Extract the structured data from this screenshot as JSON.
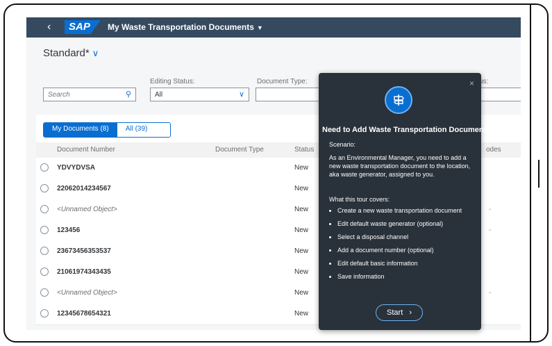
{
  "shell": {
    "back_icon": "chevron-left-icon",
    "logo_text": "SAP",
    "app_title": "My Waste Transportation Documents",
    "title_caret": "▼",
    "brand_color": "#0a6ed1",
    "bar_color": "#354a5f"
  },
  "variant": {
    "name": "Standard*",
    "chevron": "∨"
  },
  "filters": {
    "search_placeholder": "Search",
    "editing_status_label": "Editing Status:",
    "editing_status_value": "All",
    "document_type_label": "Document Type:",
    "document_type_value": "",
    "partial_label": "us:"
  },
  "segments": {
    "my_documents": "My Documents (8)",
    "all": "All (39)"
  },
  "table": {
    "columns": [
      "Document Number",
      "Document Type",
      "Status",
      "odes"
    ],
    "rows": [
      {
        "number": "YDVYDVSA",
        "status": "New",
        "italic": false,
        "dash": ""
      },
      {
        "number": "22062014234567",
        "status": "New",
        "italic": false,
        "dash": ""
      },
      {
        "number": "<Unnamed Object>",
        "status": "New",
        "italic": true,
        "dash": "-"
      },
      {
        "number": "123456",
        "status": "New",
        "italic": false,
        "dash": "-"
      },
      {
        "number": "23673456353537",
        "status": "New",
        "italic": false,
        "dash": ""
      },
      {
        "number": "21061974343435",
        "status": "New",
        "italic": false,
        "dash": ""
      },
      {
        "number": "<Unnamed Object>",
        "status": "New",
        "italic": true,
        "dash": "-"
      },
      {
        "number": "12345678654321",
        "status": "New",
        "italic": false,
        "dash": ""
      }
    ]
  },
  "tour": {
    "close_symbol": "×",
    "icon": "signpost-icon",
    "title": "Need to Add Waste Transportation Document",
    "scenario_label": "Scenario:",
    "scenario_text": "As an Environmental Manager, you need to add a new waste transportation document to the location, aka waste generator, assigned to you.",
    "covers_label": "What this tour covers:",
    "items": [
      "Create a new waste transportation document",
      "Edit default waste generator (optional)",
      "Select a disposal channel",
      "Add a document number (optional)",
      "Edit default basic information",
      "Save information"
    ],
    "start_label": "Start",
    "start_chevron": "›"
  }
}
